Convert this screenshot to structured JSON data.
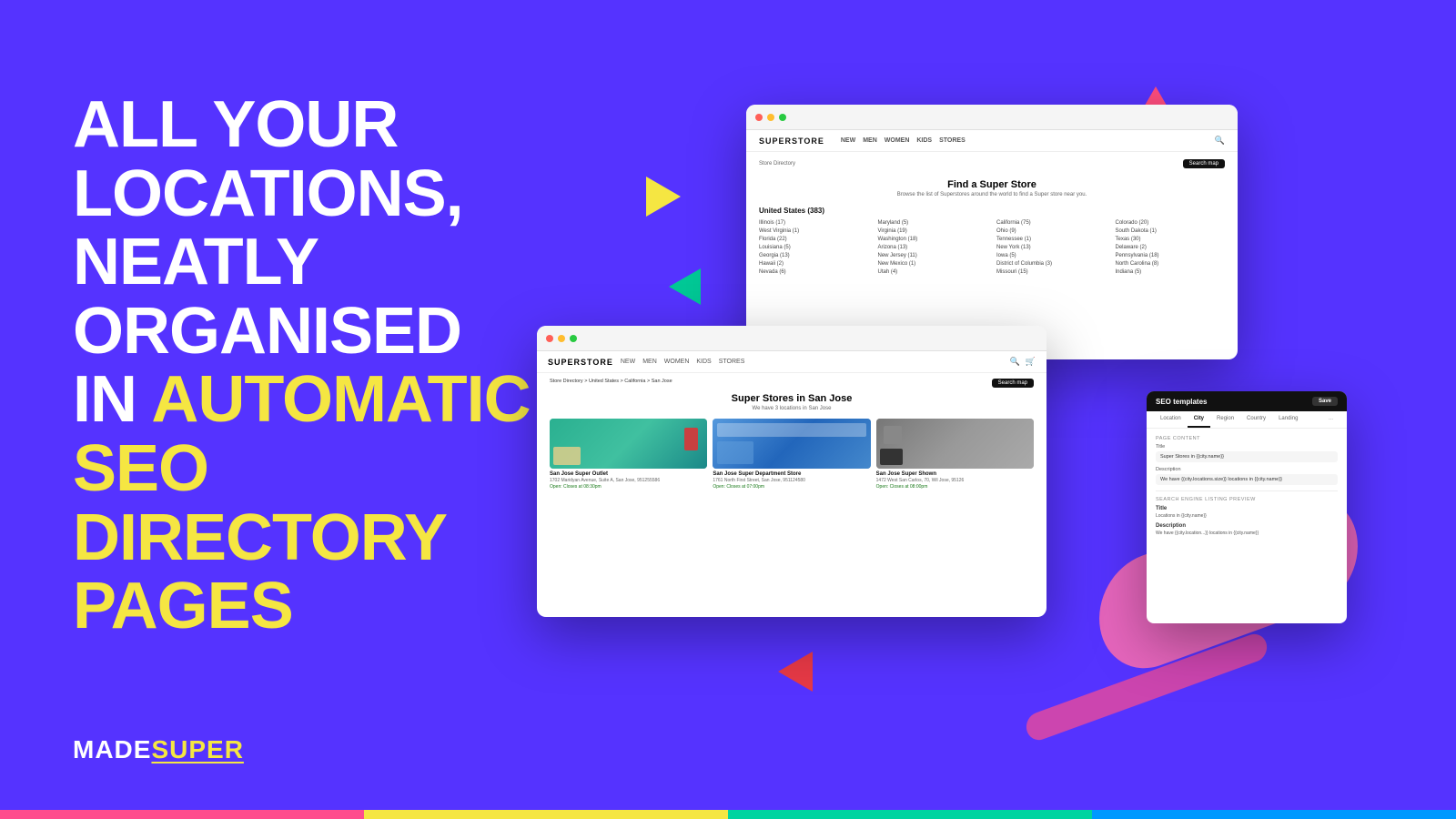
{
  "background": {
    "color": "#5533ff"
  },
  "headline": {
    "line1": "ALL YOUR LOCATIONS,",
    "line2": "NEATLY ORGANISED",
    "line3_white": "IN ",
    "line3_yellow": "AUTOMATIC SEO",
    "line4": "DIRECTORY PAGES"
  },
  "logo": {
    "made": "MADE",
    "super": "SUPER"
  },
  "window1": {
    "brand": "SUPERSTORE",
    "nav_links": [
      "NEW",
      "MEN",
      "WOMEN",
      "KIDS",
      "STORES"
    ],
    "breadcrumb": "Store Directory",
    "search_map_btn": "Search map",
    "main_title": "Find a Super Store",
    "subtitle": "Browse the list of Superstores around the world to find a Super store near you.",
    "country_header": "United States (383)",
    "locations": [
      "Illinois (17)",
      "Maryland (5)",
      "California (75)",
      "Colorado (20)",
      "West Virginia (1)",
      "Virginia (19)",
      "Ohio (9)",
      "South Dakota (1)",
      "Florida (22)",
      "Washington (18)",
      "Tennessee (1)",
      "Texas (30)",
      "Louisiana (5)",
      "Arizona (13)",
      "New York (13)",
      "Delaware (2)",
      "Georgia (13)",
      "New Jersey (11)",
      "Iowa (5)",
      "Pennsylvania (18)",
      "Hawaii (2)",
      "New Mexico (1)",
      "District of Columbia (3)",
      "North Carolina (8)",
      "Nevada (6)",
      "Utah (4)",
      "Missouri (15)",
      "Indiana (5)"
    ]
  },
  "window2": {
    "brand": "SUPERSTORE",
    "nav_links": [
      "NEW",
      "MEN",
      "WOMEN",
      "KIDS",
      "STORES"
    ],
    "breadcrumb": "Store Directory > United States > California > San Jose",
    "search_map_btn": "Search map",
    "main_title": "Super Stores in San Jose",
    "subtitle": "We have 3 locations in San Jose",
    "stores": [
      {
        "name": "San Jose Super Outlet",
        "address": "1702 Maridyan Avenue, Suite A, San Jose, 951255586",
        "hours": "Open: Closes at 08:30pm",
        "img_class": "store-img-teal"
      },
      {
        "name": "San Jose Super Department Store",
        "address": "1761 North First Street, San Jose, 951124580",
        "hours": "Open: Closes at 07:00pm",
        "img_class": "store-img-blue"
      },
      {
        "name": "San Jose Super Shown",
        "address": "1472 West San Carlos, 70, Wil Jose, 95126",
        "hours": "Open: Closes at 08:00pm",
        "img_class": "store-img-gray"
      }
    ]
  },
  "window3": {
    "title": "SEO templates",
    "save_btn": "Save",
    "tabs": [
      "Location",
      "City",
      "Region",
      "Country",
      "Landing",
      "..."
    ],
    "active_tab": "City",
    "page_content_label": "PAGE CONTENT",
    "title_label": "Title",
    "title_value": "Super Stores in {{city.name}}",
    "description_label": "Description",
    "description_value": "We have {{city.locations.size}} locations in {{city.name}}",
    "preview_label": "SEARCH ENGINE LISTING PREVIEW",
    "preview_title_label": "Title",
    "preview_title_value": "Locations in {{city.name}}",
    "preview_desc_label": "Description",
    "preview_desc_value": "We have {{city.location...}} locations in {{city.name}}"
  }
}
